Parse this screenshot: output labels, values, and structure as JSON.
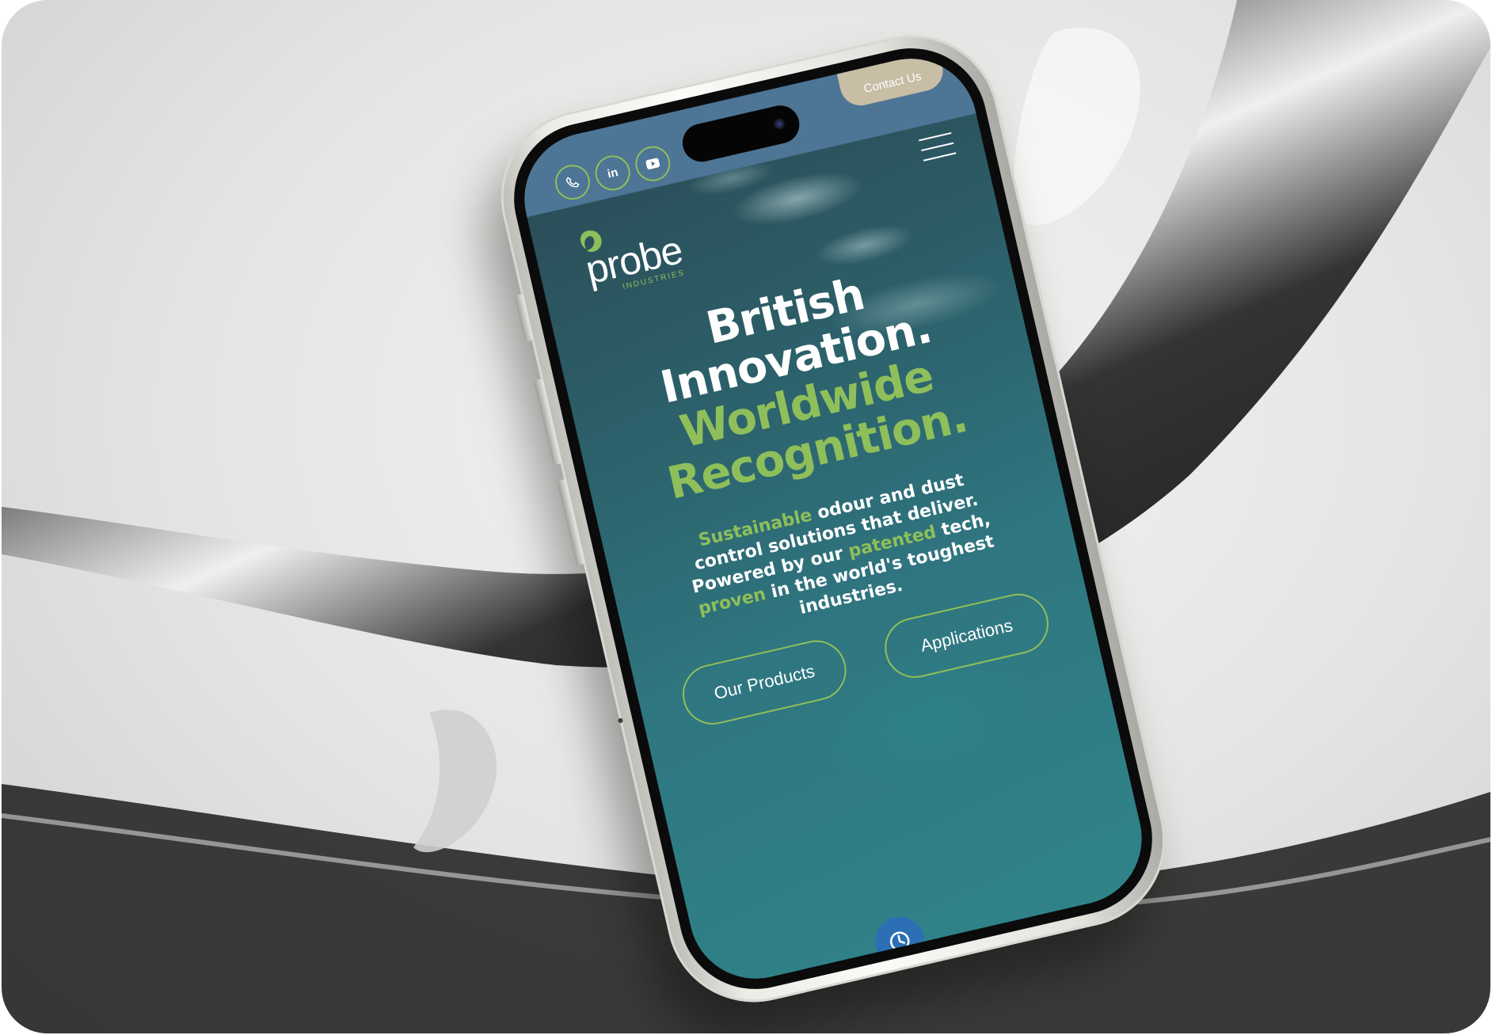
{
  "header": {
    "contact_label": "Contact Us",
    "social": [
      {
        "icon": "phone-icon"
      },
      {
        "icon": "linkedin-icon",
        "label": "in"
      },
      {
        "icon": "youtube-icon"
      }
    ],
    "menu_icon": "hamburger-menu-icon"
  },
  "logo": {
    "word": "probe",
    "sub": "INDUSTRIES",
    "mark_icon": "leaf-drop-logo-icon"
  },
  "hero": {
    "line1": "British",
    "line2": "Innovation.",
    "line3": "Worldwide",
    "line4": "Recognition.",
    "body": {
      "w1": "Sustainable",
      "t1": " odour and dust control solutions that deliver. Powered by our ",
      "w2": "patented",
      "t2": " tech, ",
      "w3": "proven",
      "t3": " in the world's toughest industries."
    }
  },
  "cta": {
    "products_label": "Our Products",
    "applications_label": "Applications"
  },
  "fab": {
    "icon": "accessibility-clock-icon"
  },
  "colors": {
    "accent_green": "#8fbf5a",
    "top_bar": "#4d7596",
    "contact_button": "#c8bda5",
    "fab_blue": "#2d6fb4"
  }
}
